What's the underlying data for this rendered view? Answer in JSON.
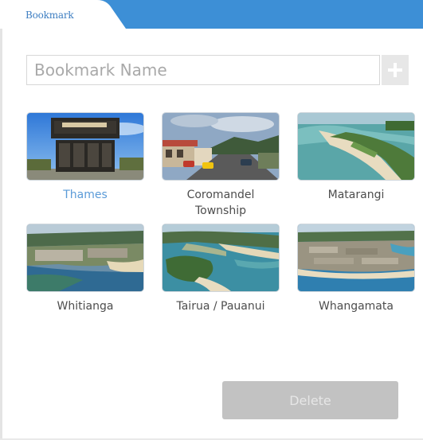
{
  "tab": {
    "label": "Bookmark"
  },
  "name_field": {
    "placeholder": "Bookmark Name",
    "value": ""
  },
  "add_button": {
    "icon": "plus-icon"
  },
  "bookmarks": [
    {
      "label": "Thames",
      "selected": true,
      "thumb": "thames-sign-photo"
    },
    {
      "label": "Coromandel Township",
      "selected": false,
      "thumb": "coromandel-street-photo"
    },
    {
      "label": "Matarangi",
      "selected": false,
      "thumb": "matarangi-aerial-photo"
    },
    {
      "label": "Whitianga",
      "selected": false,
      "thumb": "whitianga-aerial-photo"
    },
    {
      "label": "Tairua / Pauanui",
      "selected": false,
      "thumb": "tairua-aerial-photo"
    },
    {
      "label": "Whangamata",
      "selected": false,
      "thumb": "whangamata-aerial-photo"
    }
  ],
  "delete_button": {
    "label": "Delete",
    "enabled": false
  },
  "colors": {
    "accent": "#3d8fd6",
    "selected_text": "#5b9bd8",
    "button_disabled": "#c2c2c2"
  }
}
